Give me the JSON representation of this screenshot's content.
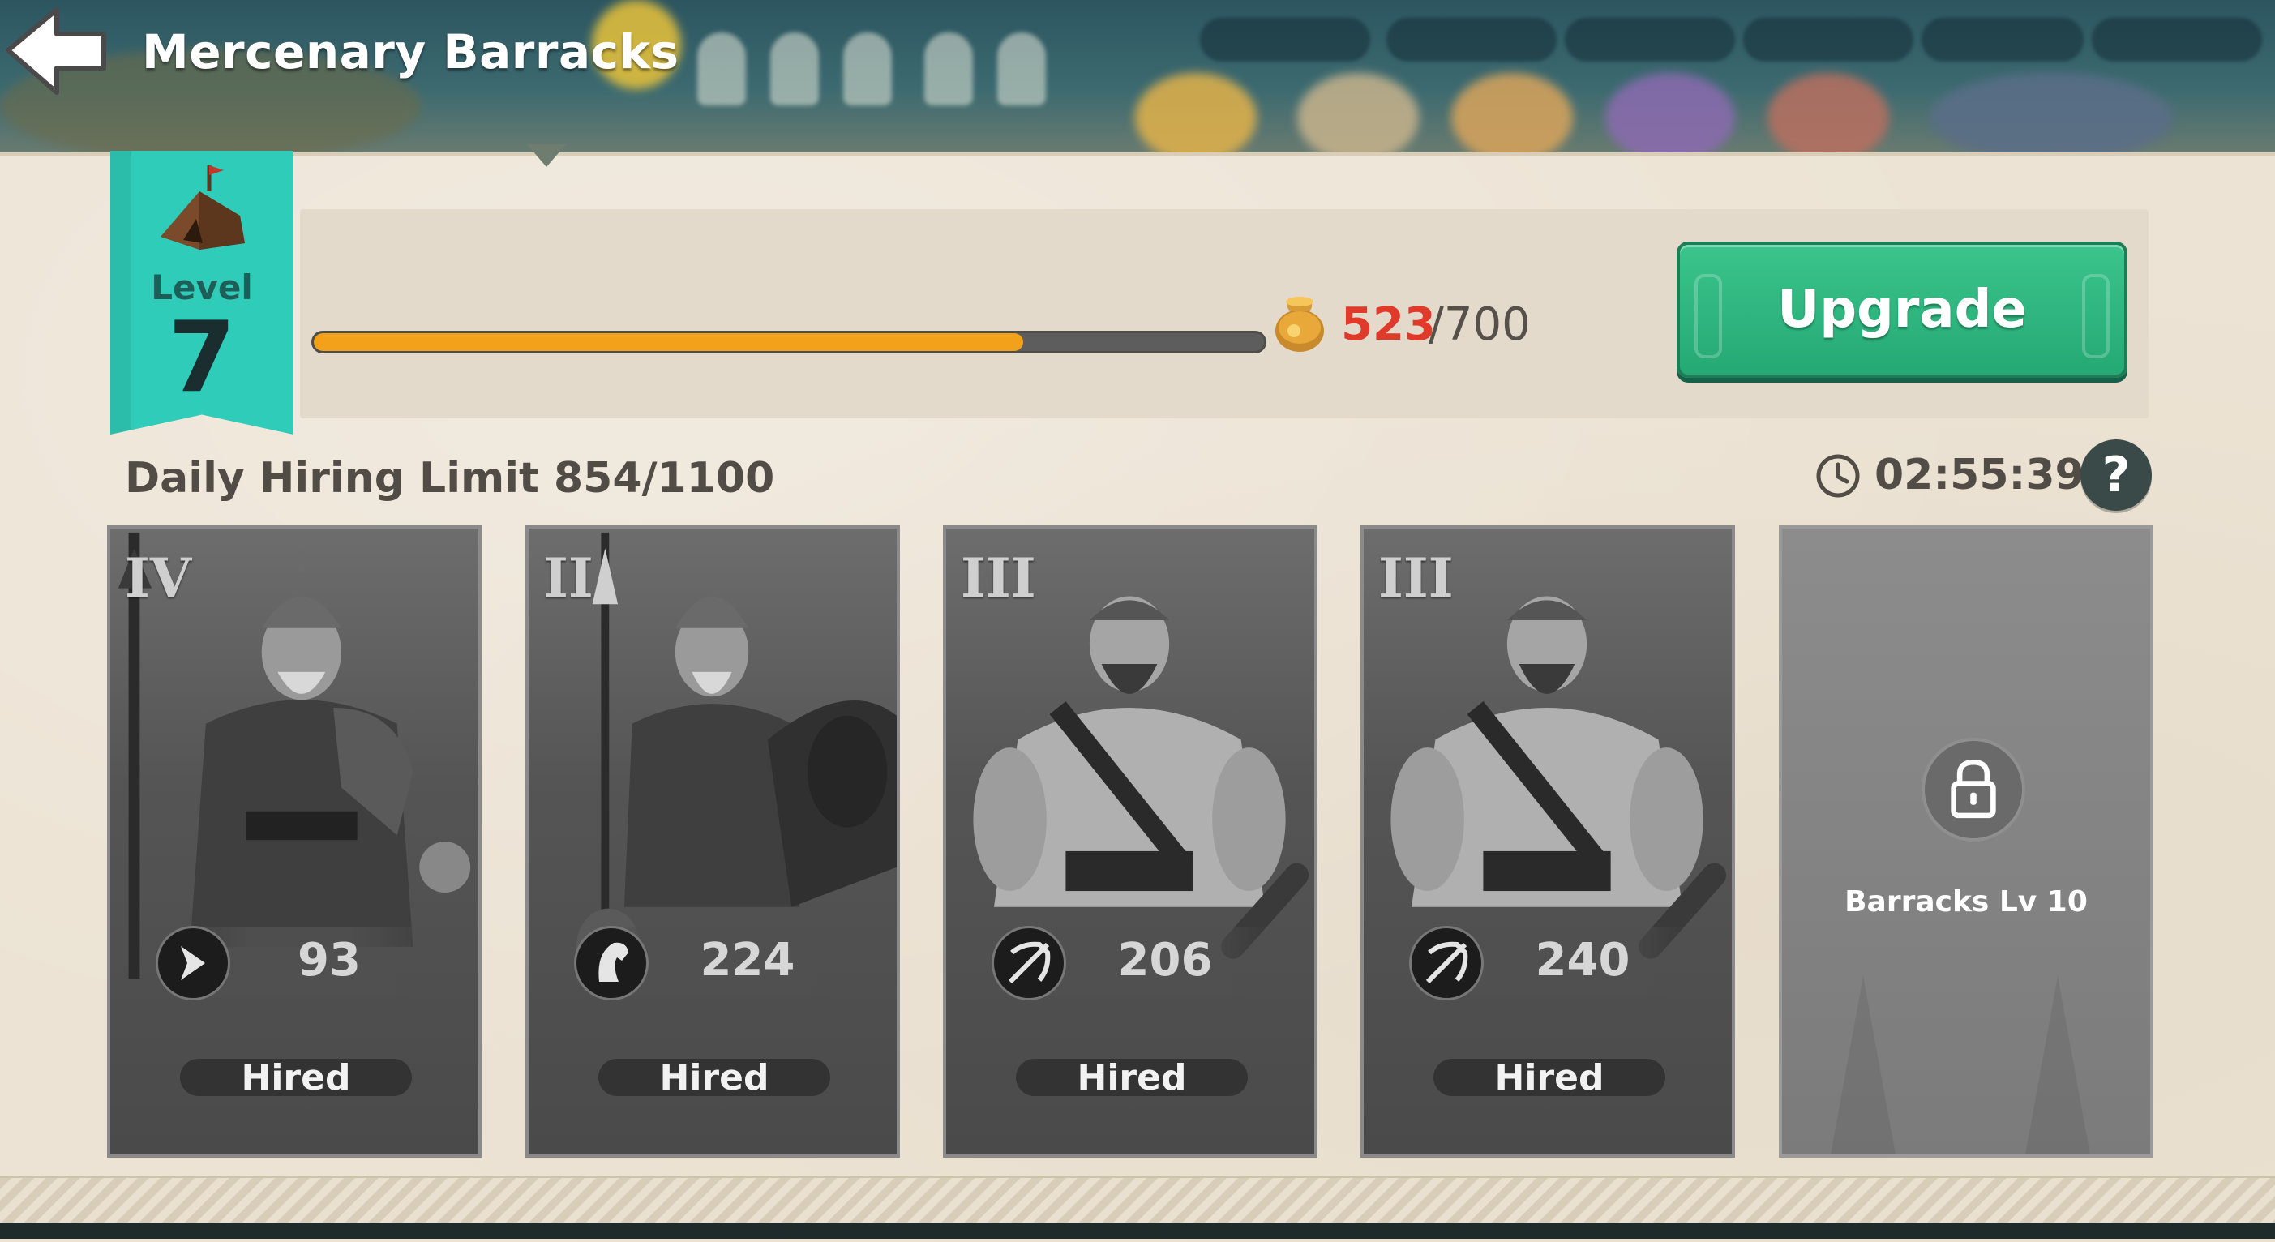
{
  "header": {
    "title": "Mercenary Barracks",
    "back_icon": "back-arrow-icon"
  },
  "building": {
    "level_label": "Level",
    "level_value": "7",
    "icon": "tent-icon"
  },
  "progress": {
    "current": "523",
    "max": "/700",
    "fraction": 0.747,
    "resource_icon": "coin-sack-icon",
    "current_color": "#e03a2a",
    "fill_color": "#f3a11a"
  },
  "upgrade": {
    "label": "Upgrade",
    "color": "#2fb67f"
  },
  "hiring": {
    "daily_limit": "Daily Hiring Limit 854/1100",
    "timer": "02:55:39",
    "clock_icon": "clock-icon",
    "help_icon": "question-mark-icon"
  },
  "cards": [
    {
      "tier": "IV",
      "power": "93",
      "type_icon": "cavalry-chevron-icon",
      "status": "Hired"
    },
    {
      "tier": "II",
      "power": "224",
      "type_icon": "horse-head-icon",
      "status": "Hired"
    },
    {
      "tier": "III",
      "power": "206",
      "type_icon": "crossed-bow-icon",
      "status": "Hired"
    },
    {
      "tier": "III",
      "power": "240",
      "type_icon": "crossed-bow-icon",
      "status": "Hired"
    }
  ],
  "locked_card": {
    "label": "Barracks Lv 10",
    "icon": "padlock-icon"
  },
  "colors": {
    "banner": "#2fcdb9",
    "parchment": "#ece3d4"
  }
}
